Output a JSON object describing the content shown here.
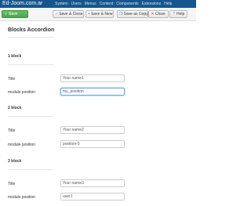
{
  "app": {
    "site_name": "Ed-Joom.com.ar",
    "menu": [
      "System",
      "Users",
      "Menus",
      "Content",
      "Components",
      "Extensions",
      "Help"
    ]
  },
  "toolbar": {
    "save": "Save",
    "save_close": "Save & Close",
    "save_new": "Save & New",
    "save_copy": "Save as Copy",
    "close": "Close",
    "help": "Help"
  },
  "page": {
    "title": "Blocks Accordion",
    "blocks": [
      {
        "heading": "1 block",
        "title_label": "Title",
        "title_value": "Your name1",
        "position_label": "module position",
        "position_value": "my_position"
      },
      {
        "heading": "2 block",
        "title_label": "Title",
        "title_value": "Your name2",
        "position_label": "module position",
        "position_value": "position-5"
      },
      {
        "heading": "3 block",
        "title_label": "Title",
        "title_value": "Your name3",
        "position_label": "module position",
        "position_value": "user1"
      }
    ]
  },
  "colors": {
    "topbar": "#17568c",
    "save_button": "#51a351"
  }
}
